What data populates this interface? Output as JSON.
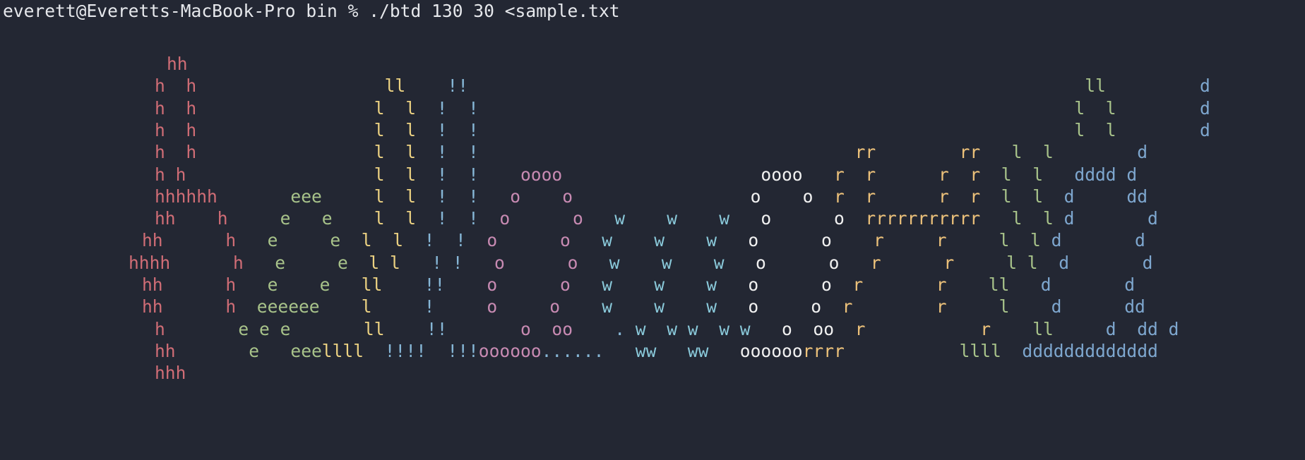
{
  "terminal": {
    "prompt": "everett@Everetts-MacBook-Pro bin % ./btd 130 30 <sample.txt"
  },
  "colors": {
    "background": "#232733",
    "prompt_text": "#e6e8ec",
    "palette": {
      "h": "#d06d76",
      "e": "#a8c38a",
      "l": "#ecd282",
      "!": "#86b6d6",
      "o": "#c78ab2",
      ".": "#86b6d6",
      "w": "#8ac9da",
      "O": "#f0f0f0",
      "r": "#ecc17a",
      "L": "#a8c38a",
      "d": "#7ea7cf"
    }
  },
  "art": [
    {
      "text": "hh",
      "map": "hh"
    },
    {
      "text": "h  h                  ll    !!                                                           ll         d",
      "map": "h  h                  ll    !!                                                           LL         d"
    },
    {
      "text": "h  h                 l  l  !  !                                                         l  l        d",
      "map": "h  h                 l  l  !  !                                                         L  L        d"
    },
    {
      "text": "h  h                 l  l  !  !                                                         l  l        d",
      "map": "h  h                 l  l  !  !                                                         L  L        d"
    },
    {
      "text": "h  h                 l  l  !  !                                    rr        rr   l  l        d",
      "map": "h  h                 l  l  !  !                                    rr        rr   L  L        d"
    },
    {
      "text": "h h                  l  l  !  !    oooo                   oooo   r  r      r  r  l  l   dddd d",
      "map": "h h                  l  l  !  !    oooo                   OOOO   r  r      r  r  L  L   dddd d"
    },
    {
      "text": "hhhhhh       eee     l  l  !  !   o    o                 o    o  r  r      r  r  l  l  d     dd",
      "map": "hhhhhh       eee     l  l  !  !   o    o                 O    O  r  r      r  r  L  L  d     dd"
    },
    {
      "text": "hh    h     e   e    l  l  !  !  o      o   w    w    w   o      o  rrrrrrrrrrr   l  l d       d",
      "map": "hh    h     e   e    l  l  !  !  o      o   w    w    w   O      O  rrrrrrrrrrr   L  L d       d"
    },
    {
      "text": "hh      h   e     e  l  l  !  !  o      o   w    w    w   o      o    r     r     l  l d       d",
      "map": "hh      h   e     e  l  l  !  !  o      o   w    w    w   O      O    r     r     L  L d       d"
    },
    {
      "text": "hhhh      h   e     e  l l   ! !   o      o   w    w    w   o      o   r      r     l l  d       d",
      "map": "hhhh      h   e     e  l l   ! !   o      o   w    w    w   O      O   r      r     L L  d       d"
    },
    {
      "text": "hh      h   e    e   ll    !!    o      o   w    w    w   o      o  r       r    ll   d       d",
      "map": "hh      h   e    e   ll    !!    o      o   w    w    w   O      O  r       r    LL   d       d"
    },
    {
      "text": "hh      h  eeeeee    l     !     o     o    w    w    w   o     o  r        r     l    d      dd",
      "map": "hh      h  eeeeee    l     !     o     o    w    w    w   O     O  r        r     L    d      dd"
    },
    {
      "text": "h       e e e       ll    !!       o  oo    . w  w w  w w   o  oo  r           r    ll     d  dd d",
      "map": "h       e e e       ll    !!       o  oo    . w  w w  w w   O  OO  r           r    LL     d  dd d"
    },
    {
      "text": "hh       e   eeellll  !!!!  !!!oooooo......   ww   ww   oooooorrrr           llll  ddddddddddddd",
      "map": "hh       e   eeellll  !!!!  !!!oooooo......   ww   ww   OOOOOOrrrr           LLLL  ddddddddddddd"
    },
    {
      "text": "hhh",
      "map": "hhh"
    }
  ]
}
